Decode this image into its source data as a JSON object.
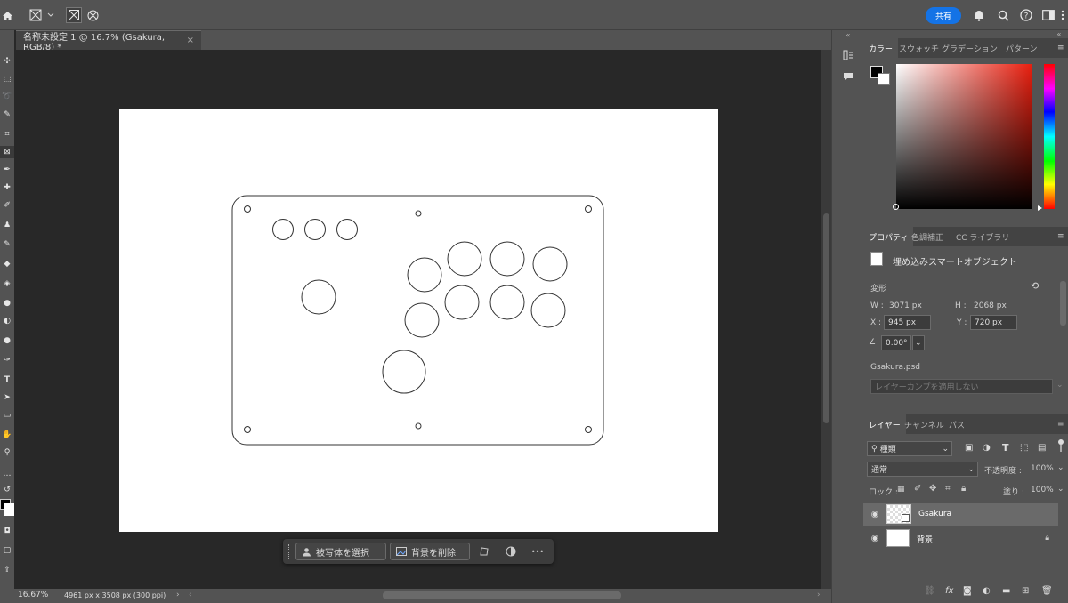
{
  "options_bar": {
    "share_label": "共有"
  },
  "document": {
    "tab_title": "名称未設定 1 @ 16.7% (Gsakura, RGB/8) *",
    "close_glyph": "×"
  },
  "context_bar": {
    "select_subject_label": "被写体を選択",
    "remove_bg_label": "背景を削除",
    "more_glyph": "•••"
  },
  "status_bar": {
    "zoom": "16.67%",
    "doc_info": "4961 px x 3508 px (300 ppi)"
  },
  "color_panel": {
    "tabs": [
      "カラー",
      "スウォッチ",
      "グラデーション",
      "パターン"
    ],
    "foreground": "#000000",
    "background": "#ffffff"
  },
  "properties_panel": {
    "tabs": [
      "プロパティ",
      "色調補正",
      "CC ライブラリ"
    ],
    "object_type": "埋め込みスマートオブジェクト",
    "transform_label": "変形",
    "w_label": "W :",
    "w_value": "3071 px",
    "h_label": "H :",
    "h_value": "2068 px",
    "x_label": "X :",
    "x_value": "945 px",
    "y_label": "Y :",
    "y_value": "720 px",
    "angle_value": "0.00°",
    "source_file": "Gsakura.psd",
    "layer_comp_placeholder": "レイヤーカンプを適用しない"
  },
  "layers_panel": {
    "tabs": [
      "レイヤー",
      "チャンネル",
      "パス"
    ],
    "filter_label": "種類",
    "blend_mode": "通常",
    "opacity_label": "不透明度 :",
    "opacity_value": "100%",
    "lock_label": "ロック :",
    "fill_label": "塗り :",
    "fill_value": "100%",
    "layers": [
      {
        "name": "Gsakura",
        "selected": true
      },
      {
        "name": "背景",
        "selected": false
      }
    ]
  },
  "colors": {
    "accent": "#1473e6",
    "panel_bg": "#535353",
    "canvas_bg": "#282828"
  }
}
